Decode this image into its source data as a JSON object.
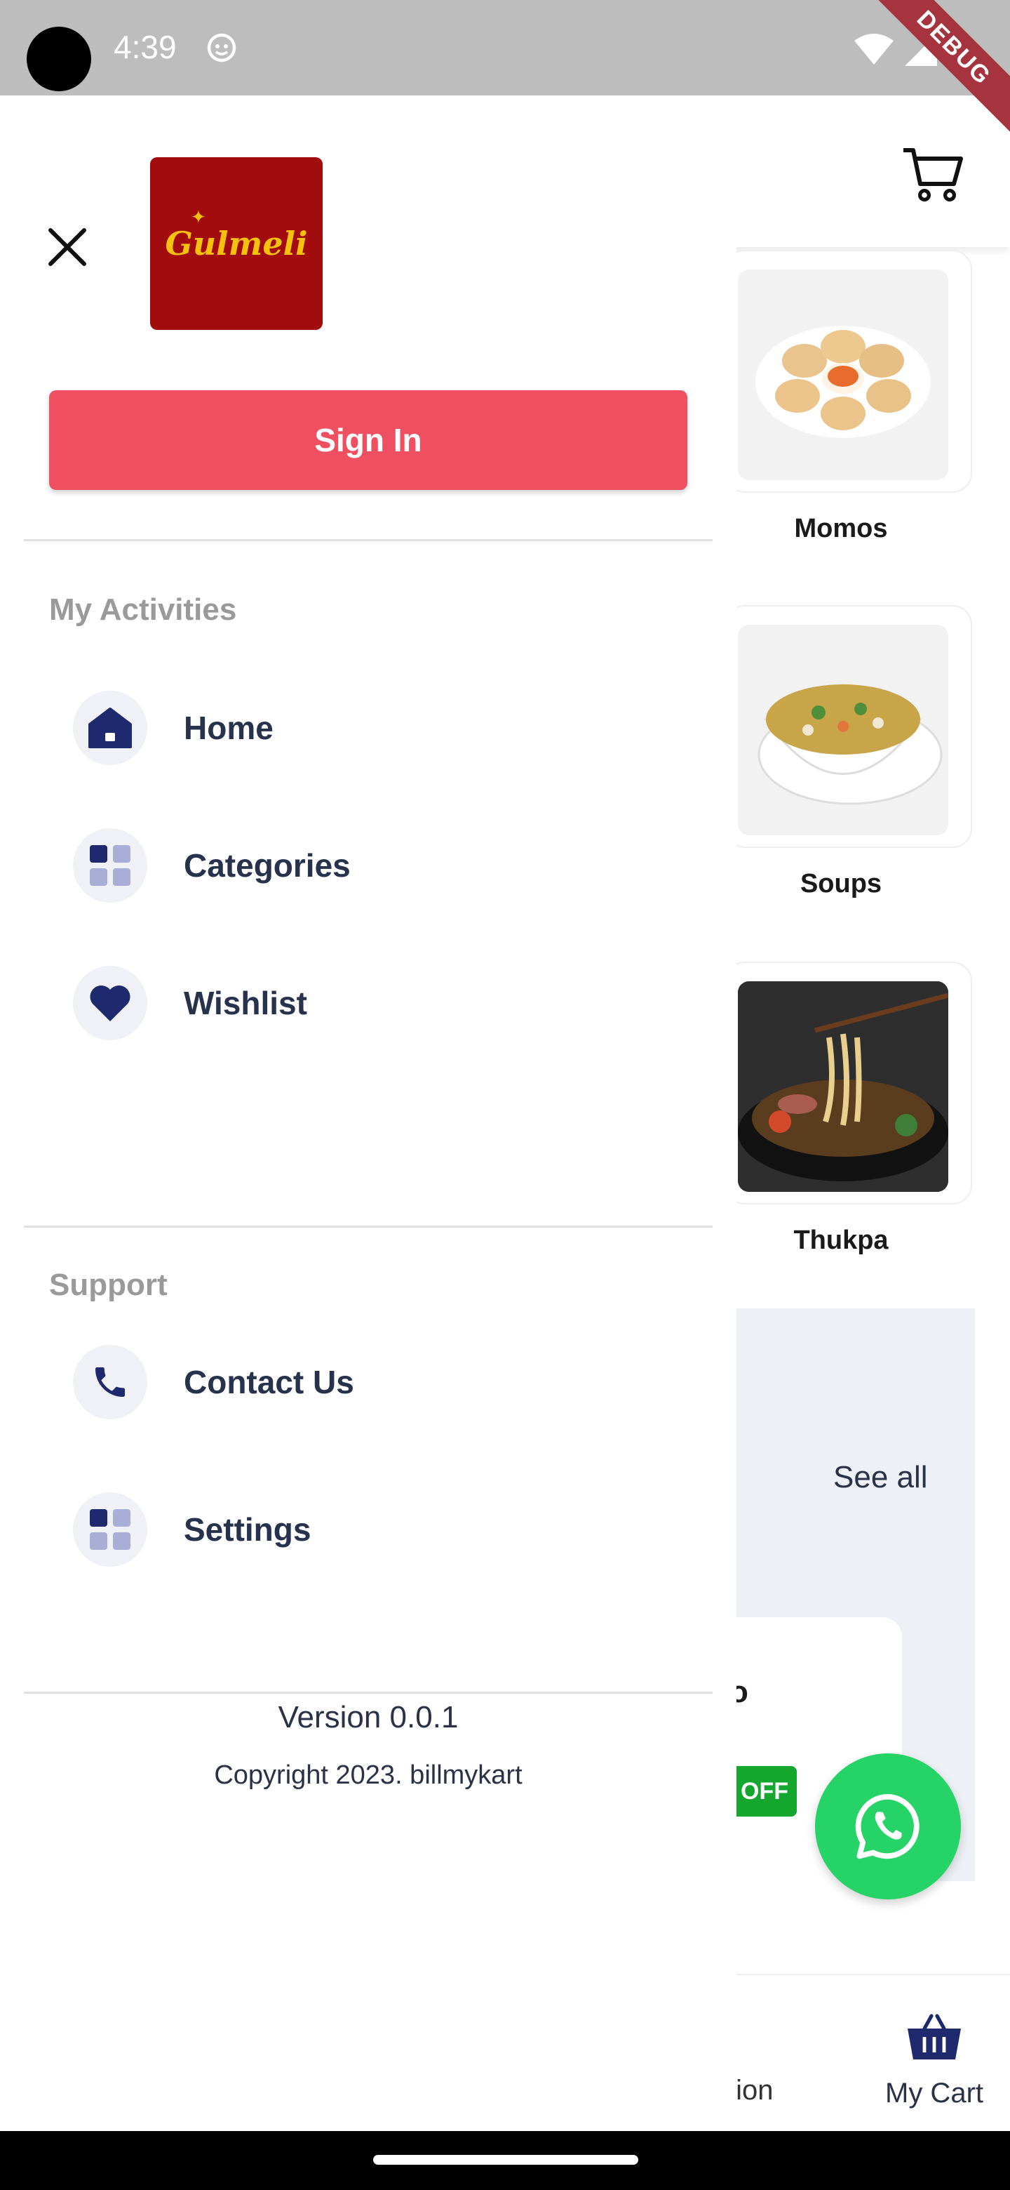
{
  "status_bar": {
    "time": "4:39",
    "debug_banner": "DEBUG"
  },
  "background": {
    "categories": [
      {
        "label": "Momos",
        "icon": "momos-image"
      },
      {
        "label": "Soups",
        "icon": "soup-image"
      },
      {
        "label": "Thukpa",
        "icon": "thukpa-image"
      }
    ],
    "see_all": "See all",
    "deal_partial_text": "o",
    "deal_off_partial": "OFF",
    "bottom_nav": {
      "partial_label": "tion",
      "cart_label": "My Cart"
    }
  },
  "drawer": {
    "logo_text": "Gulmeli",
    "sign_in_label": "Sign In",
    "activities_title": "My Activities",
    "activities": [
      {
        "label": "Home",
        "icon": "home-icon"
      },
      {
        "label": "Categories",
        "icon": "grid-icon"
      },
      {
        "label": "Wishlist",
        "icon": "heart-icon"
      }
    ],
    "support_title": "Support",
    "support": [
      {
        "label": "Contact Us",
        "icon": "phone-icon"
      },
      {
        "label": "Settings",
        "icon": "grid-icon"
      }
    ],
    "version": "Version 0.0.1",
    "copyright": "Copyright 2023. billmykart"
  },
  "colors": {
    "accent": "#ef5061",
    "icon_navy": "#1f2a6e",
    "icon_bg": "#f0f1f6",
    "whatsapp": "#25d366",
    "logo_bg": "#a30c0c",
    "logo_text": "#f4c20d"
  }
}
